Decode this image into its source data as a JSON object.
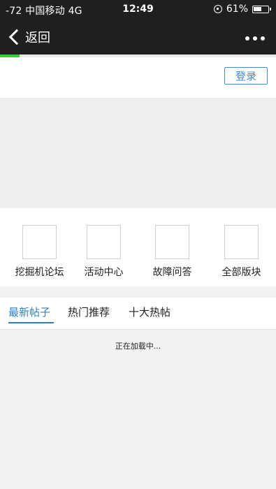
{
  "status_bar": {
    "carrier": "-72 中国移动  4G",
    "time": "12:49",
    "battery_text": "61%",
    "battery_level": 0.61
  },
  "nav": {
    "back_label": "返回",
    "more_icon": "more-dots-icon"
  },
  "page_load_progress": 0.07,
  "header": {
    "login_label": "登录"
  },
  "quick_entries": [
    {
      "label": "挖掘机论坛",
      "icon": "forum-thumbnail"
    },
    {
      "label": "活动中心",
      "icon": "activity-thumbnail"
    },
    {
      "label": "故障问答",
      "icon": "faq-thumbnail"
    },
    {
      "label": "全部版块",
      "icon": "all-sections-thumbnail"
    }
  ],
  "tabs": [
    {
      "label": "最新帖子",
      "active": true
    },
    {
      "label": "热门推荐",
      "active": false
    },
    {
      "label": "十大热帖",
      "active": false
    }
  ],
  "content": {
    "loading_text": "正在加载中..."
  },
  "colors": {
    "nav_bg": "#1f1f1f",
    "accent": "#2d7fc9",
    "progress": "#33cc33"
  }
}
